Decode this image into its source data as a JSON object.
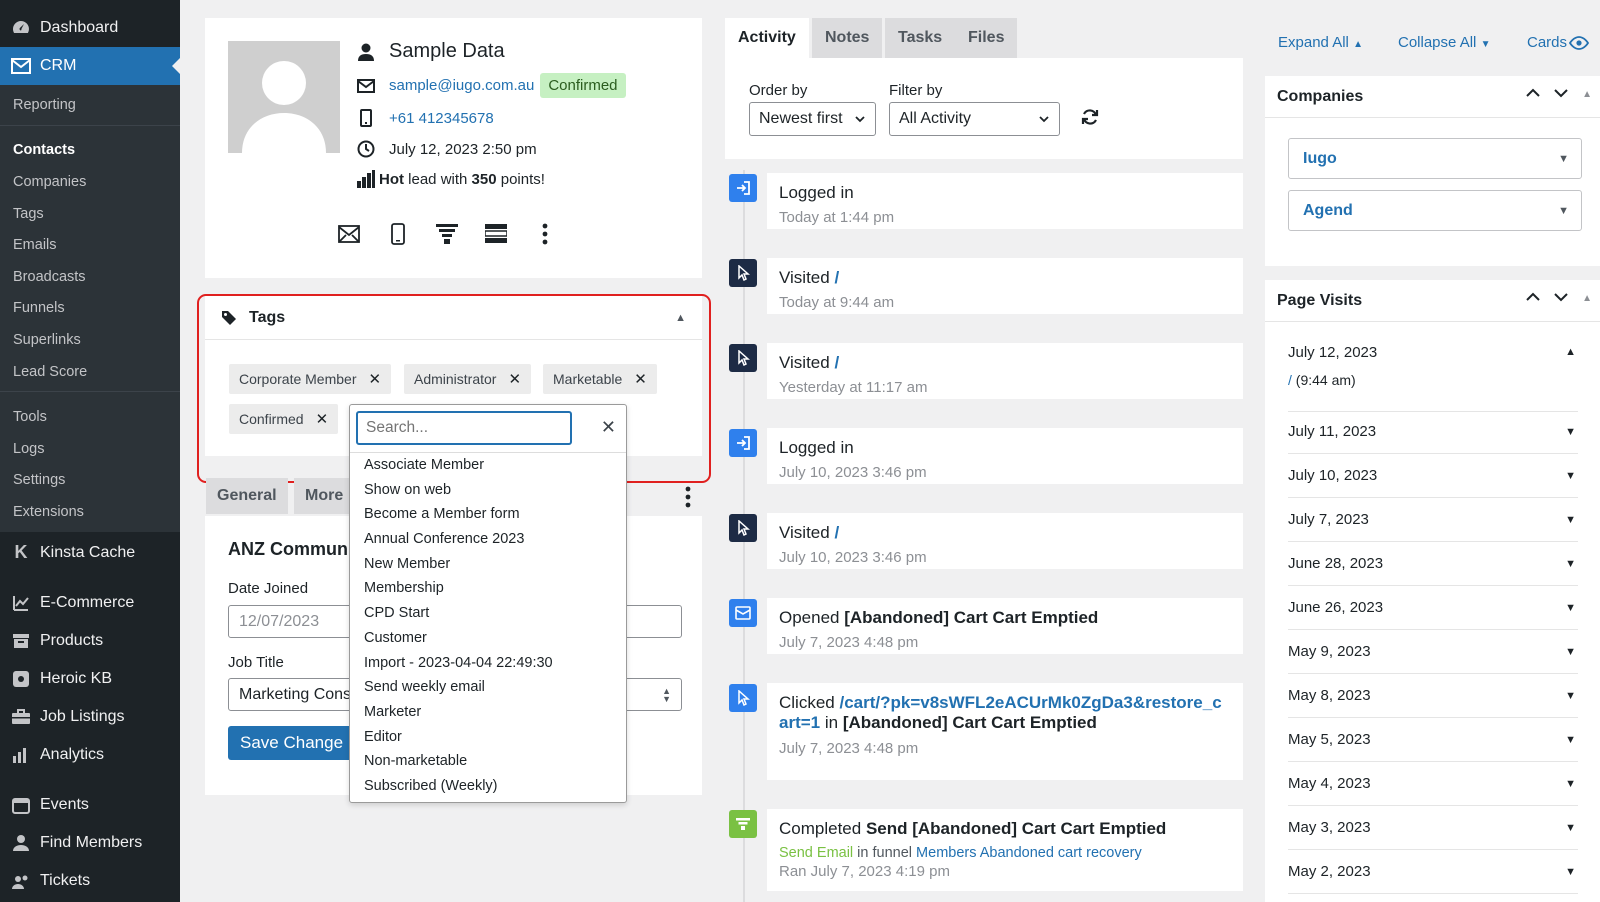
{
  "sidebar": {
    "top": [
      {
        "label": "Dashboard",
        "icon": "dashboard-icon"
      },
      {
        "label": "CRM",
        "icon": "envelope-icon"
      }
    ],
    "crm_sub": [
      "Reporting",
      "Contacts",
      "Companies",
      "Tags",
      "Emails",
      "Broadcasts",
      "Funnels",
      "Superlinks",
      "Lead Score",
      "Tools",
      "Logs",
      "Settings",
      "Extensions"
    ],
    "bottom": [
      {
        "label": "Kinsta Cache",
        "icon": "kinsta-icon"
      },
      {
        "label": "E-Commerce",
        "icon": "chart-line-icon"
      },
      {
        "label": "Products",
        "icon": "archive-icon"
      },
      {
        "label": "Heroic KB",
        "icon": "book-icon"
      },
      {
        "label": "Job Listings",
        "icon": "briefcase-icon"
      },
      {
        "label": "Analytics",
        "icon": "bar-chart-icon"
      },
      {
        "label": "Events",
        "icon": "calendar-icon"
      },
      {
        "label": "Find Members",
        "icon": "user-icon"
      },
      {
        "label": "Tickets",
        "icon": "ticket-icon"
      }
    ]
  },
  "contact": {
    "name": "Sample Data",
    "email": "sample@iugo.com.au",
    "email_status": "Confirmed",
    "phone": "+61 412345678",
    "date": "July 12, 2023 2:50 pm",
    "lead_pre": "Hot",
    "lead_mid": " lead with ",
    "lead_points": "350",
    "lead_post": " points!"
  },
  "tags": {
    "title": "Tags",
    "chips": [
      "Corporate Member",
      "Administrator",
      "Marketable",
      "Confirmed"
    ],
    "search_placeholder": "Search...",
    "options": [
      "Associate Member",
      "Show on web",
      "Become a Member form",
      "Annual Conference 2023",
      "New Member",
      "Membership",
      "CPD Start",
      "Customer",
      "Import - 2023-04-04 22:49:30",
      "Send weekly email",
      "Marketer",
      "Editor",
      "Non-marketable",
      "Subscribed (Weekly)"
    ]
  },
  "general": {
    "tabs": [
      "General",
      "More"
    ],
    "section_title": "ANZ Commun",
    "date_joined_label": "Date Joined",
    "date_day": "12",
    "date_month": "07",
    "date_year": "2023",
    "job_title_label": "Job Title",
    "job_title_value": "Marketing Cons",
    "save_label": "Save Change"
  },
  "activity": {
    "tabs": [
      "Activity",
      "Notes",
      "Tasks",
      "Files"
    ],
    "order_label": "Order by",
    "order_value": "Newest first",
    "filter_label": "Filter by",
    "filter_value": "All Activity",
    "items": [
      {
        "icon": "login-icon",
        "color": "#2f80ed",
        "title": "Logged in",
        "sub": "Today at 1:44 pm"
      },
      {
        "icon": "cursor-icon",
        "color": "#1d2b45",
        "title": "Visited",
        "link": "/",
        "sub": "Today at 9:44 am"
      },
      {
        "icon": "cursor-icon",
        "color": "#1d2b45",
        "title": "Visited",
        "link": "/",
        "sub": "Yesterday at 11:17 am"
      },
      {
        "icon": "login-icon",
        "color": "#2f80ed",
        "title": "Logged in",
        "sub": "July 10, 2023 3:46 pm"
      },
      {
        "icon": "cursor-icon",
        "color": "#1d2b45",
        "title": "Visited",
        "link": "/",
        "sub": "July 10, 2023 3:46 pm"
      },
      {
        "icon": "email-open-icon",
        "color": "#2f80ed",
        "title": "Opened",
        "bold": "[Abandoned] Cart Cart Emptied",
        "sub": "July 7, 2023 4:48 pm"
      },
      {
        "icon": "click-icon",
        "color": "#2f80ed",
        "title": "Clicked",
        "link": "/cart/?pk=v8sWFL2eACUrMk0ZgDa3&restore_cart=1",
        "in_text": " in",
        "bold": "[Abandoned] Cart Cart Emptied",
        "sub": "July 7, 2023 4:48 pm"
      },
      {
        "icon": "funnel-icon",
        "color": "#7ac143",
        "title": "Completed",
        "bold": "Send [Abandoned] Cart Cart Emptied",
        "step_label": "Send Email",
        "step_mid": " in funnel ",
        "funnel_name": "Members Abandoned cart recovery",
        "sub": "Ran July 7, 2023 4:19 pm"
      }
    ]
  },
  "right": {
    "expand_all": "Expand All",
    "collapse_all": "Collapse All",
    "cards": "Cards",
    "companies_title": "Companies",
    "companies": [
      "Iugo",
      "Agend"
    ],
    "page_visits_title": "Page Visits",
    "first_visit": {
      "date": "July 12, 2023",
      "link": "/",
      "time": " (9:44 am)"
    },
    "visit_dates": [
      "July 11, 2023",
      "July 10, 2023",
      "July 7, 2023",
      "June 28, 2023",
      "June 26, 2023",
      "May 9, 2023",
      "May 8, 2023",
      "May 5, 2023",
      "May 4, 2023",
      "May 3, 2023",
      "May 2, 2023"
    ]
  }
}
